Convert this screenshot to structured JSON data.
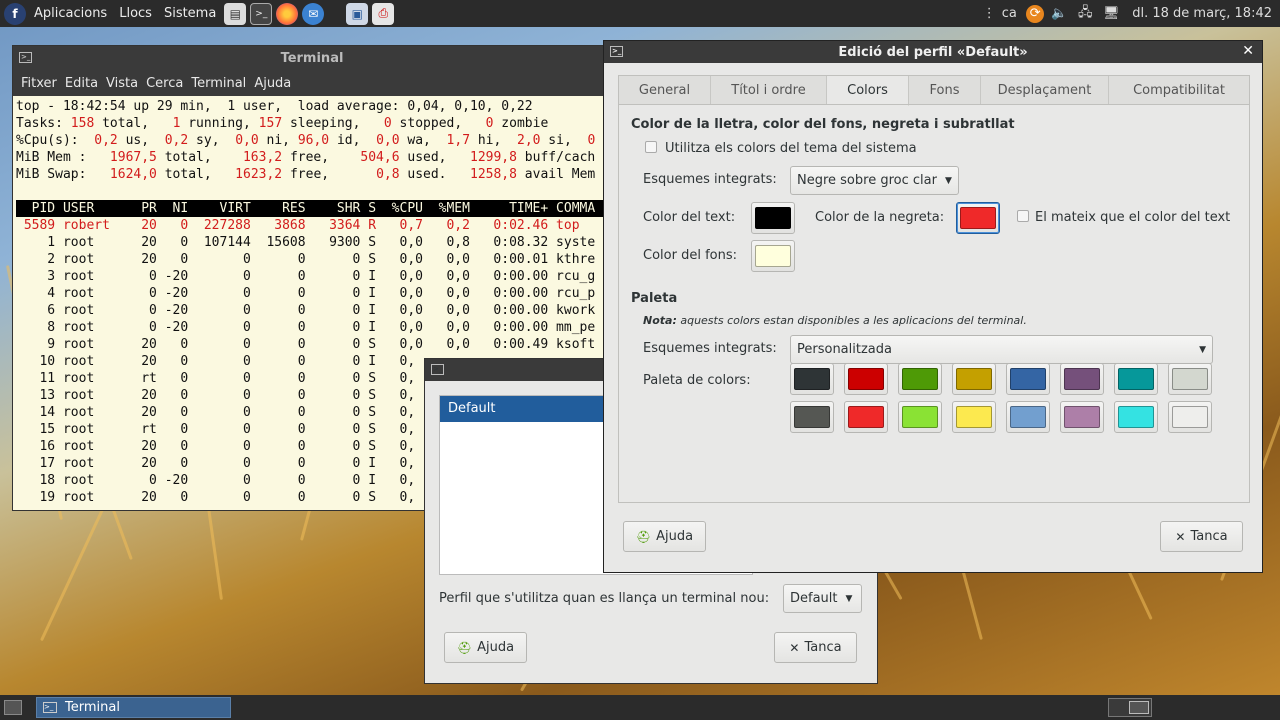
{
  "top_panel": {
    "menus": [
      "Aplicacions",
      "Llocs",
      "Sistema"
    ],
    "keyboard_layout": "ca",
    "clock": "dl. 18 de març, 18:42"
  },
  "terminal": {
    "title": "Terminal",
    "menu": [
      "Fitxer",
      "Edita",
      "Vista",
      "Cerca",
      "Terminal",
      "Ajuda"
    ],
    "top_lines": [
      "top - 18:42:54 up 29 min,  1 user,  load average: 0,04, 0,10, 0,22",
      "Tasks: 158 total,   1 running, 157 sleeping,   0 stopped,   0 zombie",
      "%Cpu(s):  0,2 us,  0,2 sy,  0,0 ni, 96,0 id,  0,0 wa,  1,7 hi,  2,0 si,  0",
      "MiB Mem :   1967,5 total,    163,2 free,    504,6 used,   1299,8 buff/cach",
      "MiB Swap:   1624,0 total,   1623,2 free,      0,8 used.   1258,8 avail Mem"
    ],
    "header": "  PID USER      PR  NI    VIRT    RES    SHR S  %CPU  %MEM     TIME+ COMMA",
    "rows": [
      " 5589 robert    20   0  227288   3868   3364 R   0,7   0,2   0:02.46 top",
      "    1 root      20   0  107144  15608   9300 S   0,0   0,8   0:08.32 syste",
      "    2 root      20   0       0      0      0 S   0,0   0,0   0:00.01 kthre",
      "    3 root       0 -20       0      0      0 I   0,0   0,0   0:00.00 rcu_g",
      "    4 root       0 -20       0      0      0 I   0,0   0,0   0:00.00 rcu_p",
      "    6 root       0 -20       0      0      0 I   0,0   0,0   0:00.00 kwork",
      "    8 root       0 -20       0      0      0 I   0,0   0,0   0:00.00 mm_pe",
      "    9 root      20   0       0      0      0 S   0,0   0,0   0:00.49 ksoft",
      "   10 root      20   0       0      0      0 I   0,",
      "   11 root      rt   0       0      0      0 S   0,",
      "   13 root      20   0       0      0      0 S   0,",
      "   14 root      20   0       0      0      0 S   0,",
      "   15 root      rt   0       0      0      0 S   0,",
      "   16 root      20   0       0      0      0 S   0,",
      "   17 root      20   0       0      0      0 I   0,",
      "   18 root       0 -20       0      0      0 I   0,",
      "   19 root      20   0       0      0      0 S   0,"
    ]
  },
  "profiles_window": {
    "profile_list": [
      "Default"
    ],
    "launch_label": "Perfil que s'utilitza quan es llança un terminal nou:",
    "launch_value": "Default",
    "help_button": "Ajuda",
    "close_button": "Tanca"
  },
  "dialog": {
    "title": "Edició del perfil «Default»",
    "tabs": [
      "General",
      "Títol i ordre",
      "Colors",
      "Fons",
      "Desplaçament",
      "Compatibilitat"
    ],
    "active_tab": "Colors",
    "section_fg": "Color de la lletra, color del fons, negreta i subratllat",
    "use_system_colors": "Utilitza els colors del tema del sistema",
    "builtin_schemes_label": "Esquemes integrats:",
    "builtin_schemes_value": "Negre sobre groc clar",
    "text_color_label": "Color del text:",
    "text_color": "#000000",
    "bold_color_label": "Color de la negreta:",
    "bold_color": "#ef2929",
    "same_as_text": "El mateix que el color del text",
    "bg_color_label": "Color del fons:",
    "bg_color": "#ffffdd",
    "section_palette": "Paleta",
    "note_bold": "Nota:",
    "note_text": " aquests colors estan disponibles a les aplicacions del terminal.",
    "palette_schemes_label": "Esquemes integrats:",
    "palette_schemes_value": "Personalitzada",
    "palette_label": "Paleta de colors:",
    "palette_row1": [
      "#2e3436",
      "#cc0000",
      "#4e9a06",
      "#c4a000",
      "#3465a4",
      "#75507b",
      "#06989a",
      "#d3d7cf"
    ],
    "palette_row2": [
      "#555753",
      "#ef2929",
      "#8ae234",
      "#fce94f",
      "#729fcf",
      "#ad7fa8",
      "#34e2e2",
      "#eeeeec"
    ],
    "help_button": "Ajuda",
    "close_button": "Tanca"
  },
  "bottom_panel": {
    "task": "Terminal"
  }
}
